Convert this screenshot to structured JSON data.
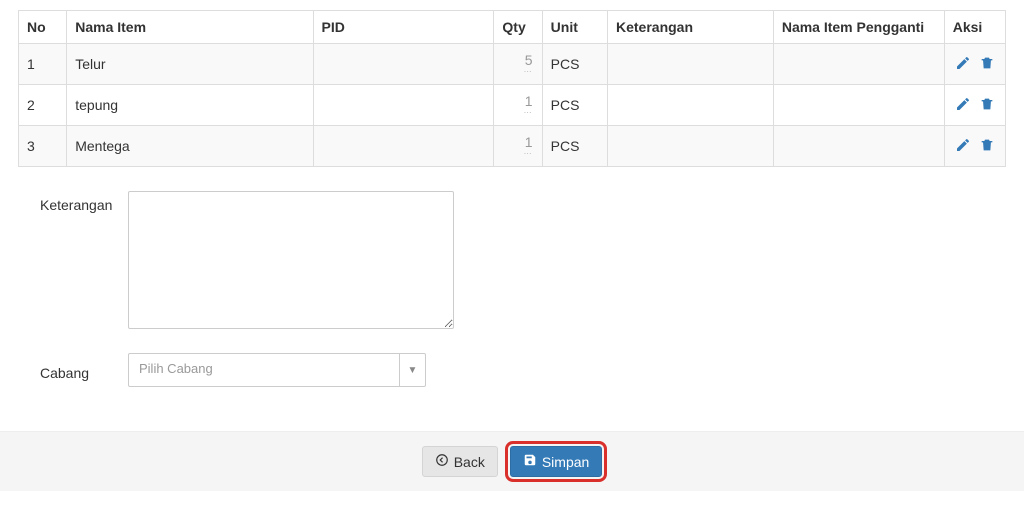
{
  "table": {
    "headers": {
      "no": "No",
      "nama_item": "Nama Item",
      "pid": "PID",
      "qty": "Qty",
      "unit": "Unit",
      "keterangan": "Keterangan",
      "nama_pengganti": "Nama Item Pengganti",
      "aksi": "Aksi"
    },
    "rows": [
      {
        "no": "1",
        "nama": "Telur",
        "pid": "",
        "qty": "5",
        "unit": "PCS",
        "ket": "",
        "peng": ""
      },
      {
        "no": "2",
        "nama": "tepung",
        "pid": "",
        "qty": "1",
        "unit": "PCS",
        "ket": "",
        "peng": ""
      },
      {
        "no": "3",
        "nama": "Mentega",
        "pid": "",
        "qty": "1",
        "unit": "PCS",
        "ket": "",
        "peng": ""
      }
    ]
  },
  "form": {
    "keterangan_label": "Keterangan",
    "keterangan_value": "",
    "cabang_label": "Cabang",
    "cabang_placeholder": "Pilih Cabang"
  },
  "buttons": {
    "back": "Back",
    "simpan": "Simpan"
  }
}
